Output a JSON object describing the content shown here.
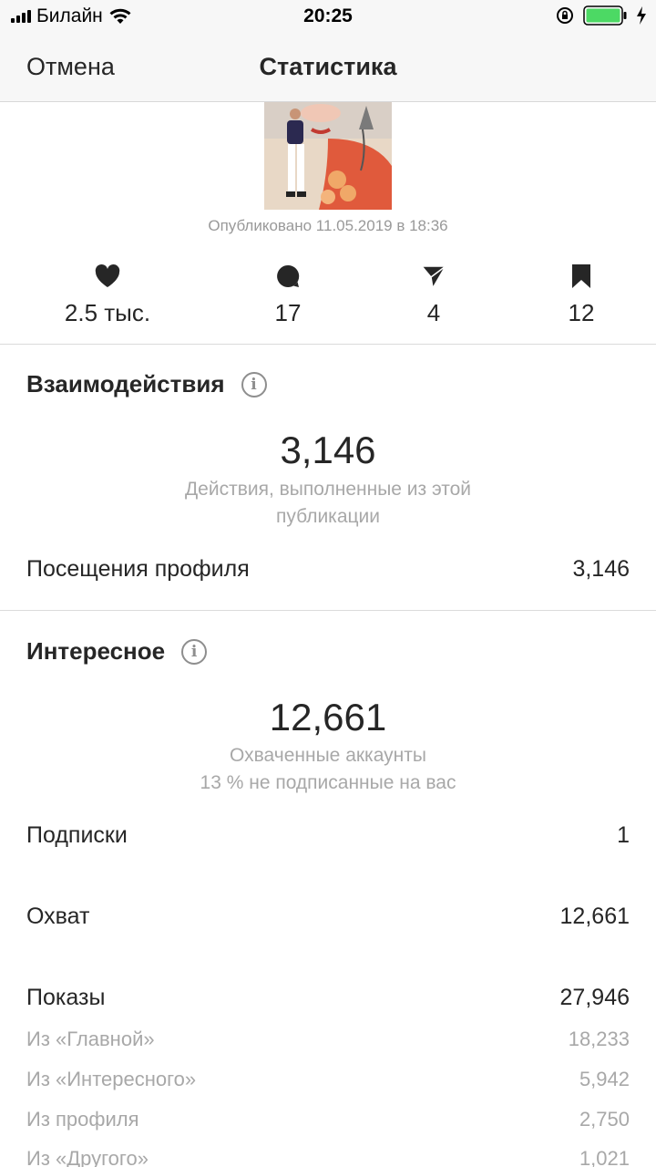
{
  "status_bar": {
    "carrier": "Билайн",
    "time": "20:25",
    "icons": [
      "signal-icon",
      "wifi-icon",
      "orientation-lock-icon",
      "battery-icon",
      "charging-icon"
    ]
  },
  "nav": {
    "cancel_label": "Отмена",
    "title": "Статистика"
  },
  "post": {
    "thumbnail_icon": "post-photo-thumbnail",
    "published": "Опубликовано 11.05.2019 в 18:36"
  },
  "counts": {
    "likes": "2.5 тыс.",
    "comments": "17",
    "shares": "4",
    "saves": "12"
  },
  "interactions": {
    "title": "Взаимодействия",
    "total": "3,146",
    "caption_line1": "Действия, выполненные из этой",
    "caption_line2": "публикации",
    "profile_visits_label": "Посещения профиля",
    "profile_visits_value": "3,146"
  },
  "discovery": {
    "title": "Интересное",
    "total": "12,661",
    "caption_line1": "Охваченные аккаунты",
    "caption_line2": "13 % не подписанные на вас",
    "follows_label": "Подписки",
    "follows_value": "1",
    "reach_label": "Охват",
    "reach_value": "12,661",
    "impressions_label": "Показы",
    "impressions_value": "27,946",
    "from_home_label": "Из «Главной»",
    "from_home_value": "18,233",
    "from_explore_label": "Из «Интересного»",
    "from_explore_value": "5,942",
    "from_profile_label": "Из профиля",
    "from_profile_value": "2,750",
    "from_other_label": "Из «Другого»",
    "from_other_value": "1,021"
  },
  "colors": {
    "text": "#262626",
    "secondary": "#a8a8a8",
    "bar_bg": "#f7f7f7",
    "battery": "#4cd964"
  }
}
